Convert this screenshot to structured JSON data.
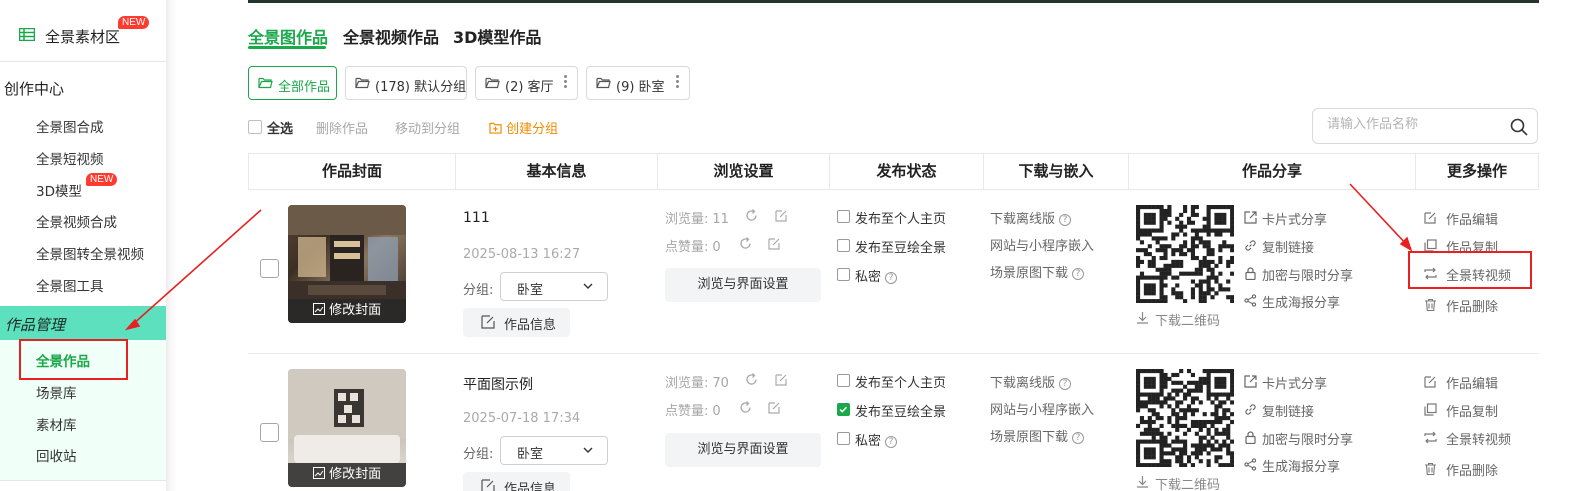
{
  "sidebar": {
    "top_item": {
      "label": "全景素材区",
      "badge": "NEW"
    },
    "section_create": "创作中心",
    "create_items": [
      {
        "label": "全景图合成"
      },
      {
        "label": "全景短视频"
      },
      {
        "label": "3D模型",
        "badge": "NEW"
      },
      {
        "label": "全景视频合成"
      },
      {
        "label": "全景图转全景视频"
      },
      {
        "label": "全景图工具"
      }
    ],
    "section_manage": "作品管理",
    "manage_items": [
      {
        "label": "全景作品"
      },
      {
        "label": "场景库"
      },
      {
        "label": "素材库"
      },
      {
        "label": "回收站"
      }
    ]
  },
  "tabs": [
    "全景图作品",
    "全景视频作品",
    "3D模型作品"
  ],
  "groups": [
    {
      "label": "全部作品"
    },
    {
      "label": "(178) 默认分组"
    },
    {
      "label": "(2) 客厅"
    },
    {
      "label": "(9) 卧室"
    }
  ],
  "actions": {
    "select_all": "全选",
    "delete": "删除作品",
    "move": "移动到分组",
    "create_group": "创建分组"
  },
  "search": {
    "placeholder": "请输入作品名称",
    "value": ""
  },
  "columns": [
    "作品封面",
    "基本信息",
    "浏览设置",
    "发布状态",
    "下载与嵌入",
    "作品分享",
    "更多操作"
  ],
  "rows": [
    {
      "cover_edit": "修改封面",
      "title": "111",
      "date": "2025-08-13 16:27",
      "group_label": "分组:",
      "group_value": "卧室",
      "info_btn": "作品信息",
      "views_label": "浏览量:",
      "views": "11",
      "likes_label": "点赞量:",
      "likes": "0",
      "browse_btn": "浏览与界面设置",
      "publish": [
        {
          "label": "发布至个人主页",
          "checked": false,
          "help": false
        },
        {
          "label": "发布至豆绘全景",
          "checked": false,
          "help": false
        },
        {
          "label": "私密",
          "checked": false,
          "help": true
        }
      ],
      "downloads": [
        "下载离线版",
        "网站与小程序嵌入",
        "场景原图下载"
      ],
      "qr_download": "下载二维码",
      "share": [
        "卡片式分享",
        "复制链接",
        "加密与限时分享",
        "生成海报分享"
      ],
      "more": [
        "作品编辑",
        "作品复制",
        "全景转视频",
        "作品删除"
      ]
    },
    {
      "cover_edit": "修改封面",
      "title": "平面图示例",
      "date": "2025-07-18 17:34",
      "group_label": "分组:",
      "group_value": "卧室",
      "info_btn": "作品信息",
      "views_label": "浏览量:",
      "views": "70",
      "likes_label": "点赞量:",
      "likes": "0",
      "browse_btn": "浏览与界面设置",
      "publish": [
        {
          "label": "发布至个人主页",
          "checked": false,
          "help": false
        },
        {
          "label": "发布至豆绘全景",
          "checked": true,
          "help": false
        },
        {
          "label": "私密",
          "checked": false,
          "help": true
        }
      ],
      "downloads": [
        "下载离线版",
        "网站与小程序嵌入",
        "场景原图下载"
      ],
      "qr_download": "下载二维码",
      "share": [
        "卡片式分享",
        "复制链接",
        "加密与限时分享",
        "生成海报分享"
      ],
      "more": [
        "作品编辑",
        "作品复制",
        "全景转视频",
        "作品删除"
      ]
    }
  ],
  "colors": {
    "accent": "#1aa84a",
    "create": "#f08c00",
    "annotation": "#e82020",
    "manage_bar": "#5ce0bd"
  }
}
